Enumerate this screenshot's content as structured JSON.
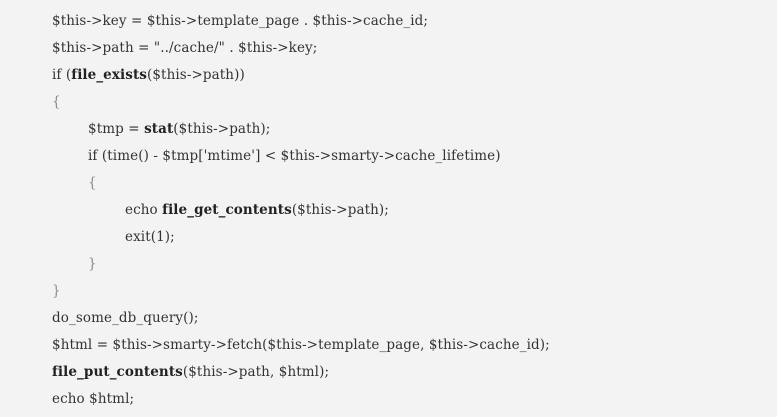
{
  "code": {
    "lines": [
      {
        "indent": 0,
        "segments": [
          {
            "text": "$this->key = $this->template_page . $this->cache_id;",
            "bold": false
          }
        ]
      },
      {
        "indent": 0,
        "segments": [
          {
            "text": "$this->path = \"../cache/\" . $this->key;",
            "bold": false
          }
        ]
      },
      {
        "indent": 0,
        "segments": [
          {
            "text": "if (",
            "bold": false
          },
          {
            "text": "file_exists",
            "bold": true
          },
          {
            "text": "($this->path))",
            "bold": false
          }
        ]
      },
      {
        "indent": 0,
        "segments": [
          {
            "text": "{",
            "bold": false,
            "brace": true
          }
        ]
      },
      {
        "indent": 1,
        "segments": [
          {
            "text": "$tmp = ",
            "bold": false
          },
          {
            "text": "stat",
            "bold": true
          },
          {
            "text": "($this->path);",
            "bold": false
          }
        ]
      },
      {
        "indent": 1,
        "segments": [
          {
            "text": "if (time() - $tmp['mtime'] < $this->smarty->cache_lifetime)",
            "bold": false
          }
        ]
      },
      {
        "indent": 1,
        "segments": [
          {
            "text": "{",
            "bold": false,
            "brace": true
          }
        ]
      },
      {
        "indent": 2,
        "segments": [
          {
            "text": "echo ",
            "bold": false
          },
          {
            "text": "file_get_contents",
            "bold": true
          },
          {
            "text": "($this->path);",
            "bold": false
          }
        ]
      },
      {
        "indent": 2,
        "segments": [
          {
            "text": "exit(1);",
            "bold": false
          }
        ]
      },
      {
        "indent": 1,
        "segments": [
          {
            "text": "}",
            "bold": false,
            "brace": true
          }
        ]
      },
      {
        "indent": 0,
        "segments": [
          {
            "text": "}",
            "bold": false,
            "brace": true
          }
        ]
      },
      {
        "indent": 0,
        "segments": [
          {
            "text": "do_some_db_query();",
            "bold": false
          }
        ]
      },
      {
        "indent": 0,
        "segments": [
          {
            "text": "$html = $this->smarty->fetch($this->template_page, $this->cache_id);",
            "bold": false
          }
        ]
      },
      {
        "indent": 0,
        "segments": [
          {
            "text": "file_put_contents",
            "bold": true
          },
          {
            "text": "($this->path, $html);",
            "bold": false
          }
        ]
      },
      {
        "indent": 0,
        "segments": [
          {
            "text": "echo $html;",
            "bold": false
          }
        ]
      }
    ]
  }
}
